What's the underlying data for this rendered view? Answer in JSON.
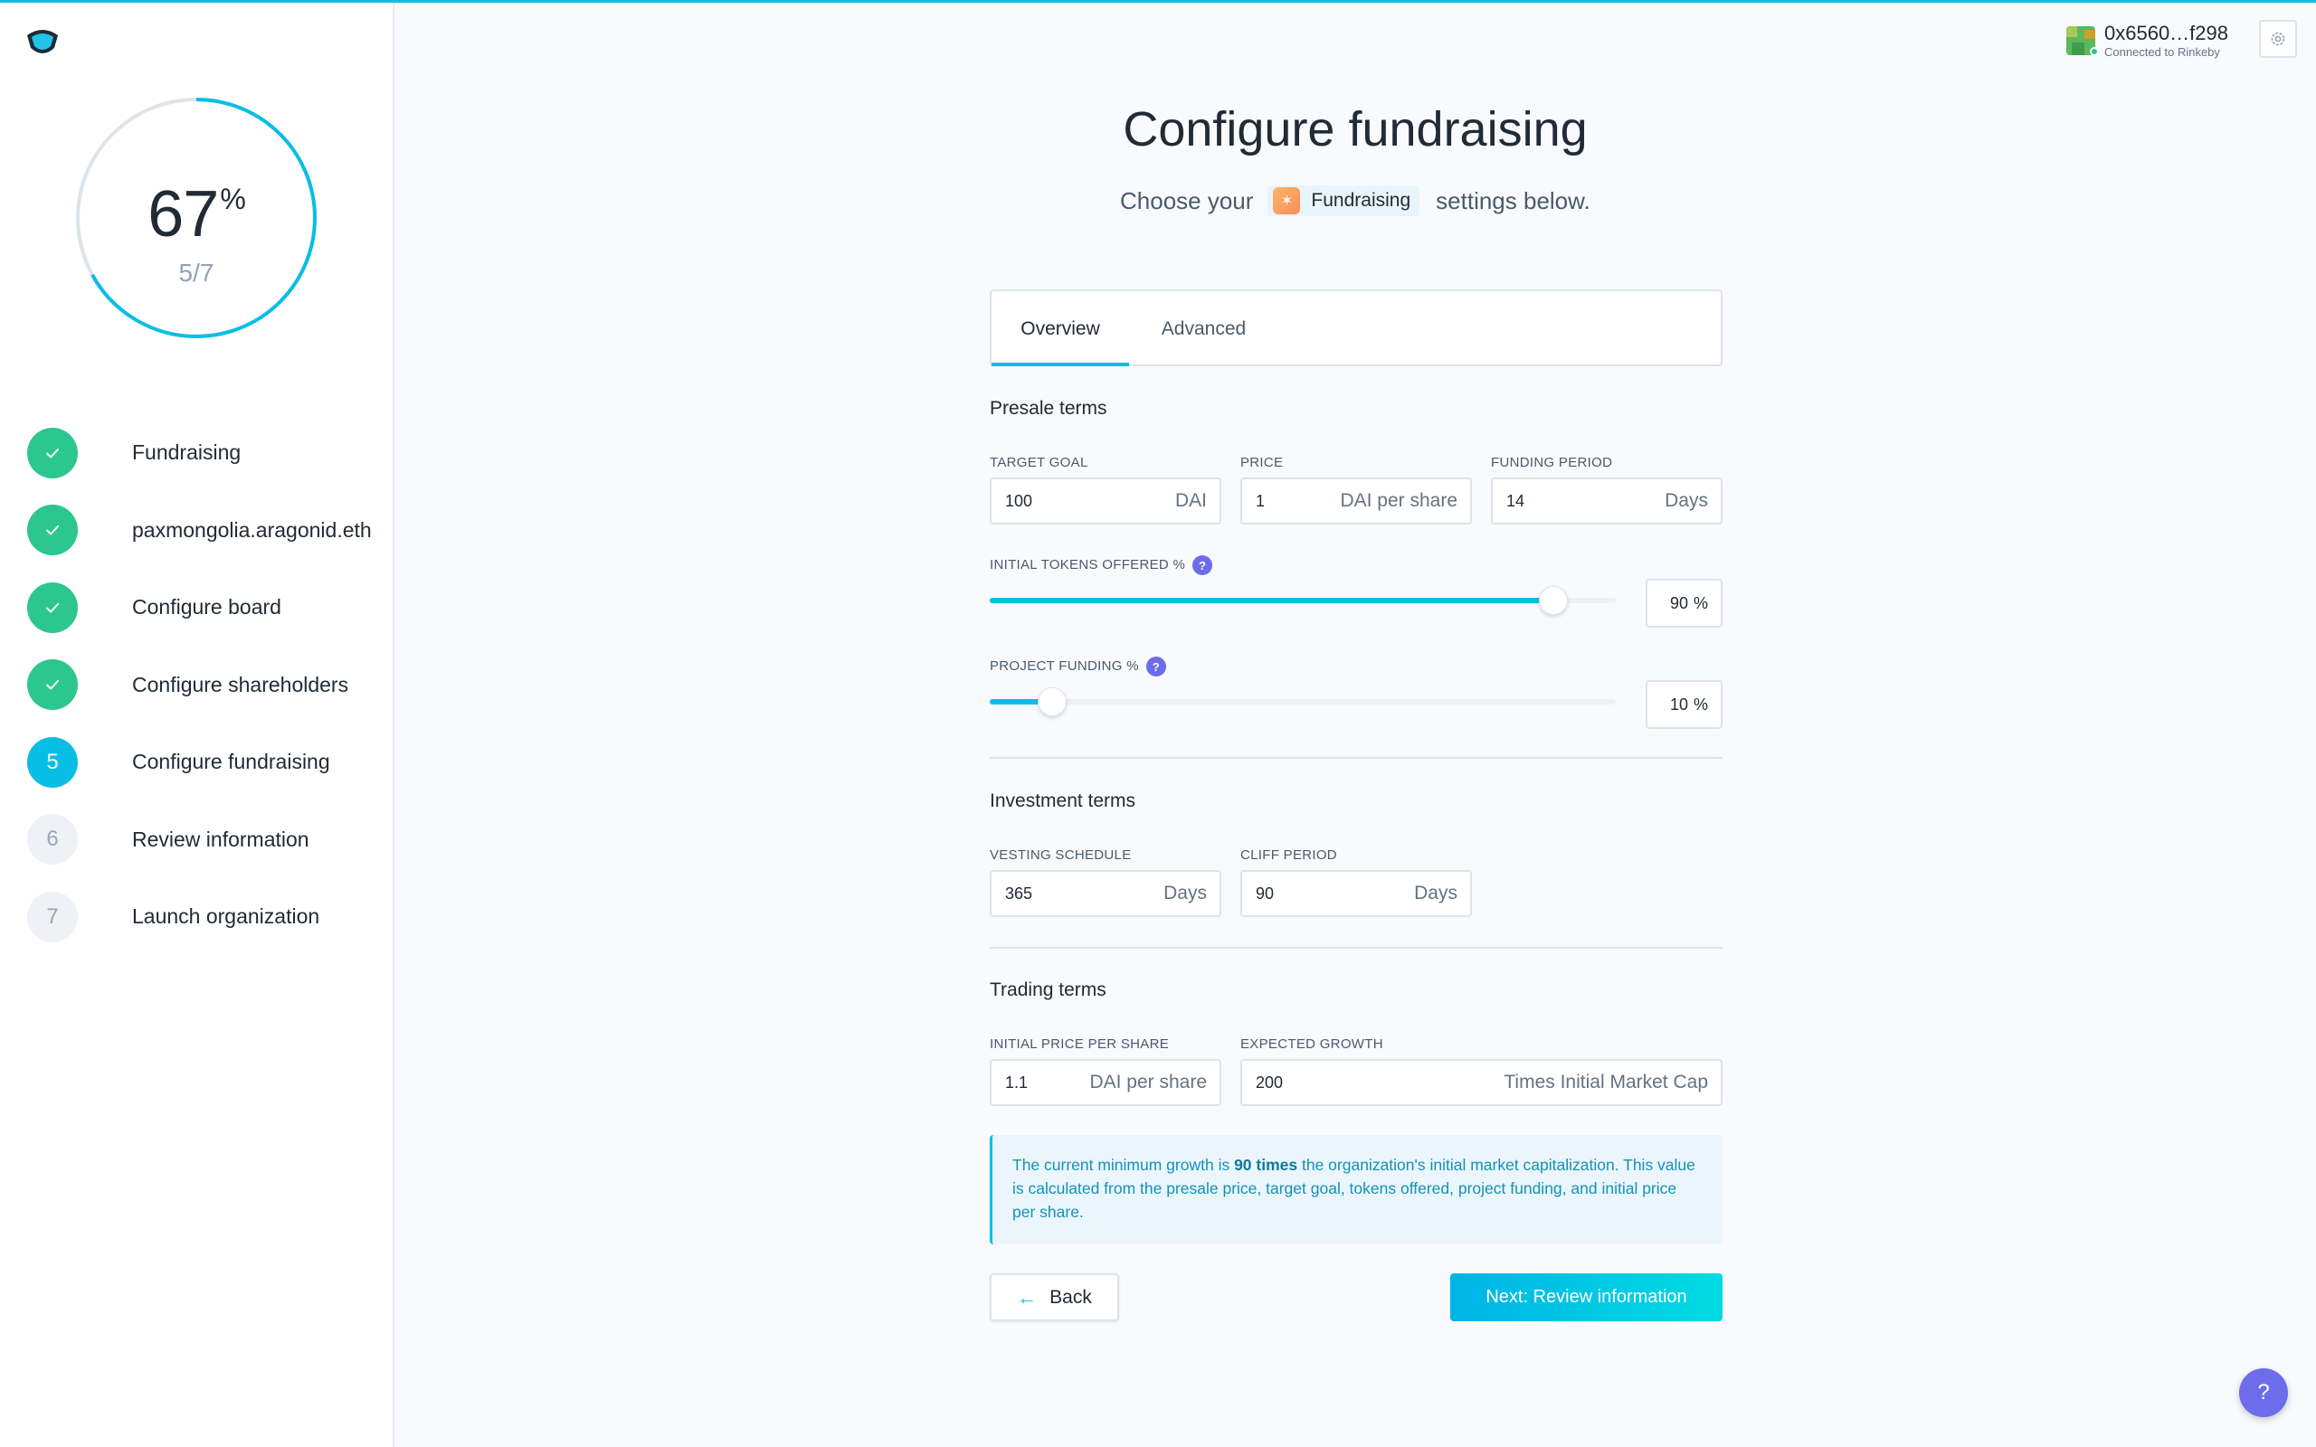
{
  "colors": {
    "accent": "#08bee5",
    "done": "#2cc68f",
    "help": "#6d6ceb"
  },
  "progress": {
    "percent": "67",
    "percent_sign": "%",
    "count": "5/7",
    "fraction": 0.67
  },
  "steps": [
    {
      "badge": "",
      "label": "Fundraising",
      "state": "done"
    },
    {
      "badge": "",
      "label": "paxmongolia.aragonid.eth",
      "state": "done"
    },
    {
      "badge": "",
      "label": "Configure board",
      "state": "done"
    },
    {
      "badge": "",
      "label": "Configure shareholders",
      "state": "done"
    },
    {
      "badge": "5",
      "label": "Configure fundraising",
      "state": "active"
    },
    {
      "badge": "6",
      "label": "Review information",
      "state": "todo"
    },
    {
      "badge": "7",
      "label": "Launch organization",
      "state": "todo"
    }
  ],
  "account": {
    "address": "0x6560…f298",
    "network": "Connected to Rinkeby"
  },
  "header": {
    "title": "Configure fundraising",
    "subtitle_before": "Choose your",
    "app_name": "Fundraising",
    "subtitle_after": "settings below."
  },
  "tabs": [
    "Overview",
    "Advanced"
  ],
  "presale": {
    "title": "Presale terms",
    "target_goal": {
      "label": "TARGET GOAL",
      "value": "100",
      "unit": "DAI"
    },
    "price": {
      "label": "PRICE",
      "value": "1",
      "unit": "DAI per share"
    },
    "funding_period": {
      "label": "FUNDING PERIOD",
      "value": "14",
      "unit": "Days"
    },
    "tokens_offered": {
      "label": "INITIAL TOKENS OFFERED %",
      "value": "90",
      "unit": "%",
      "level": 0.9
    },
    "project_funding": {
      "label": "PROJECT FUNDING %",
      "value": "10",
      "unit": "%",
      "level": 0.1
    }
  },
  "investment": {
    "title": "Investment terms",
    "vesting": {
      "label": "VESTING SCHEDULE",
      "value": "365",
      "unit": "Days"
    },
    "cliff": {
      "label": "CLIFF PERIOD",
      "value": "90",
      "unit": "Days"
    }
  },
  "trading": {
    "title": "Trading terms",
    "initial_price": {
      "label": "INITIAL PRICE PER SHARE",
      "value": "1.1",
      "unit": "DAI per share"
    },
    "expected_growth": {
      "label": "EXPECTED GROWTH",
      "value": "200",
      "unit": "Times Initial Market Cap"
    }
  },
  "info": {
    "part1": "The current minimum growth is ",
    "bold": "90 times",
    "part2": " the organization's initial market capitalization. This value is calculated from the presale price, target goal, tokens offered, project funding, and initial price per share."
  },
  "buttons": {
    "back": "Back",
    "next": "Next: Review information",
    "help": "?"
  }
}
